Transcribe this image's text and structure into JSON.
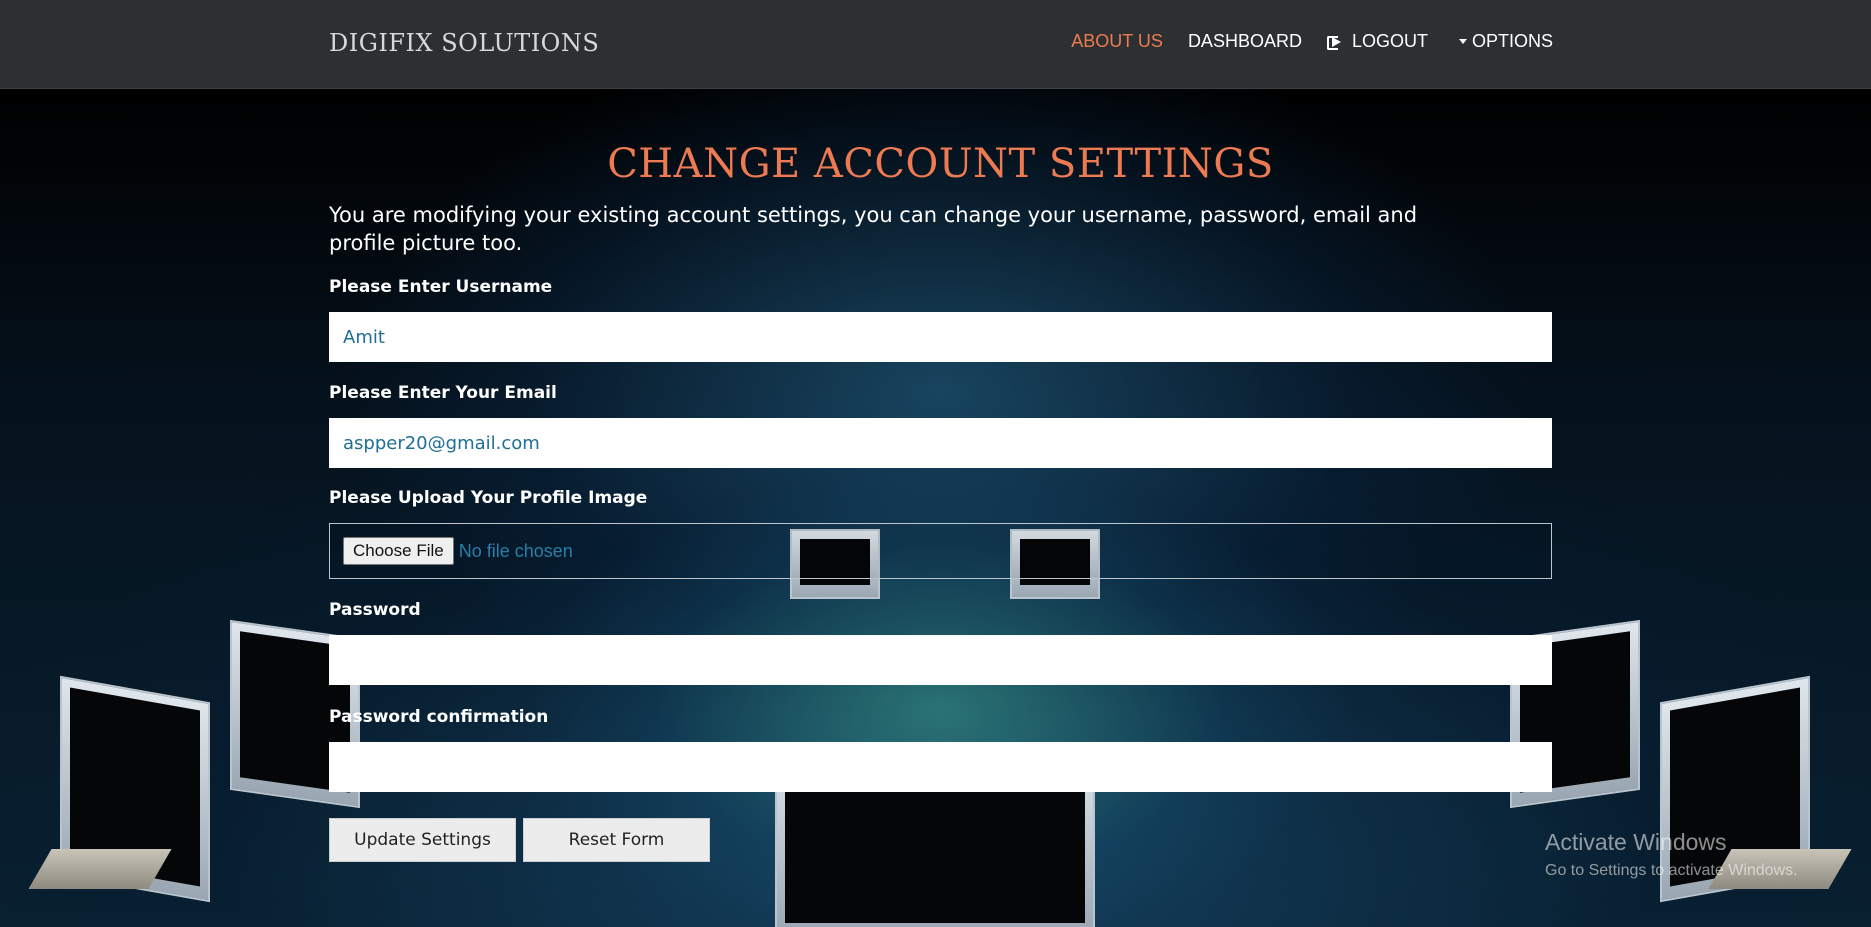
{
  "navbar": {
    "brand": "DIGIFIX SOLUTIONS",
    "links": {
      "about": "ABOUT US",
      "dashboard": "DASHBOARD",
      "logout": "LOGOUT",
      "options": "OPTIONS"
    },
    "active_color": "#ee7a52"
  },
  "main": {
    "title": "CHANGE ACCOUNT SETTINGS",
    "intro": "You are modifying your existing account settings, you can change your username, password, email and profile picture too.",
    "username": {
      "label": "Please Enter Username",
      "value": "Amit"
    },
    "email": {
      "label": "Please Enter Your Email",
      "value": "aspper20@gmail.com"
    },
    "profile_image": {
      "label": "Please Upload Your Profile Image",
      "button": "Choose File",
      "status": "No file chosen"
    },
    "password": {
      "label": "Password",
      "value": ""
    },
    "password_confirmation": {
      "label": "Password confirmation",
      "value": ""
    },
    "buttons": {
      "update": "Update Settings",
      "reset": "Reset Form"
    }
  },
  "watermark": {
    "title": "Activate Windows",
    "subtitle": "Go to Settings to activate Windows."
  },
  "icons": [
    "logout-icon",
    "caret-down-icon"
  ]
}
